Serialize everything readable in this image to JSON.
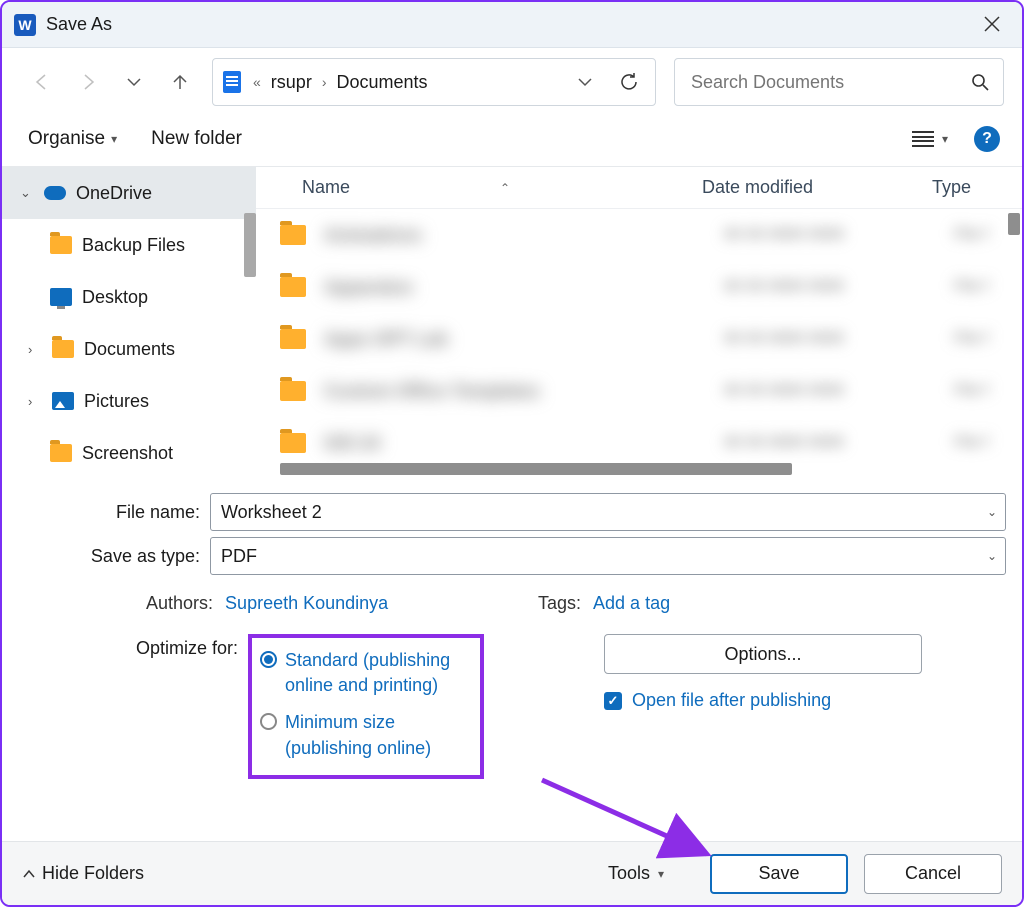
{
  "titlebar": {
    "title": "Save As",
    "app_letter": "W"
  },
  "nav": {
    "path_parent": "rsupr",
    "path_current": "Documents",
    "search_placeholder": "Search Documents"
  },
  "toolbar": {
    "organise": "Organise",
    "new_folder": "New folder"
  },
  "tree": {
    "items": [
      {
        "label": "OneDrive",
        "expandable": true,
        "expanded": true,
        "icon": "cloud",
        "current": true
      },
      {
        "label": "Backup Files",
        "expandable": false,
        "icon": "folder"
      },
      {
        "label": "Desktop",
        "expandable": false,
        "icon": "monitor"
      },
      {
        "label": "Documents",
        "expandable": true,
        "expanded": false,
        "icon": "folder"
      },
      {
        "label": "Pictures",
        "expandable": true,
        "expanded": false,
        "icon": "pic"
      },
      {
        "label": "Screenshot",
        "expandable": false,
        "icon": "folder"
      }
    ]
  },
  "columns": {
    "name": "Name",
    "date": "Date modified",
    "type": "Type"
  },
  "form": {
    "filename_label": "File name:",
    "filename_value": "Worksheet 2",
    "savetype_label": "Save as type:",
    "savetype_value": "PDF",
    "authors_label": "Authors:",
    "authors_value": "Supreeth Koundinya",
    "tags_label": "Tags:",
    "tags_value": "Add a tag",
    "optimize_label": "Optimize for:",
    "radio_standard": "Standard (publishing online and printing)",
    "radio_minimum": "Minimum size (publishing online)",
    "options_btn": "Options...",
    "open_after": "Open file after publishing"
  },
  "footer": {
    "hide_folders": "Hide Folders",
    "tools": "Tools",
    "save": "Save",
    "cancel": "Cancel"
  }
}
